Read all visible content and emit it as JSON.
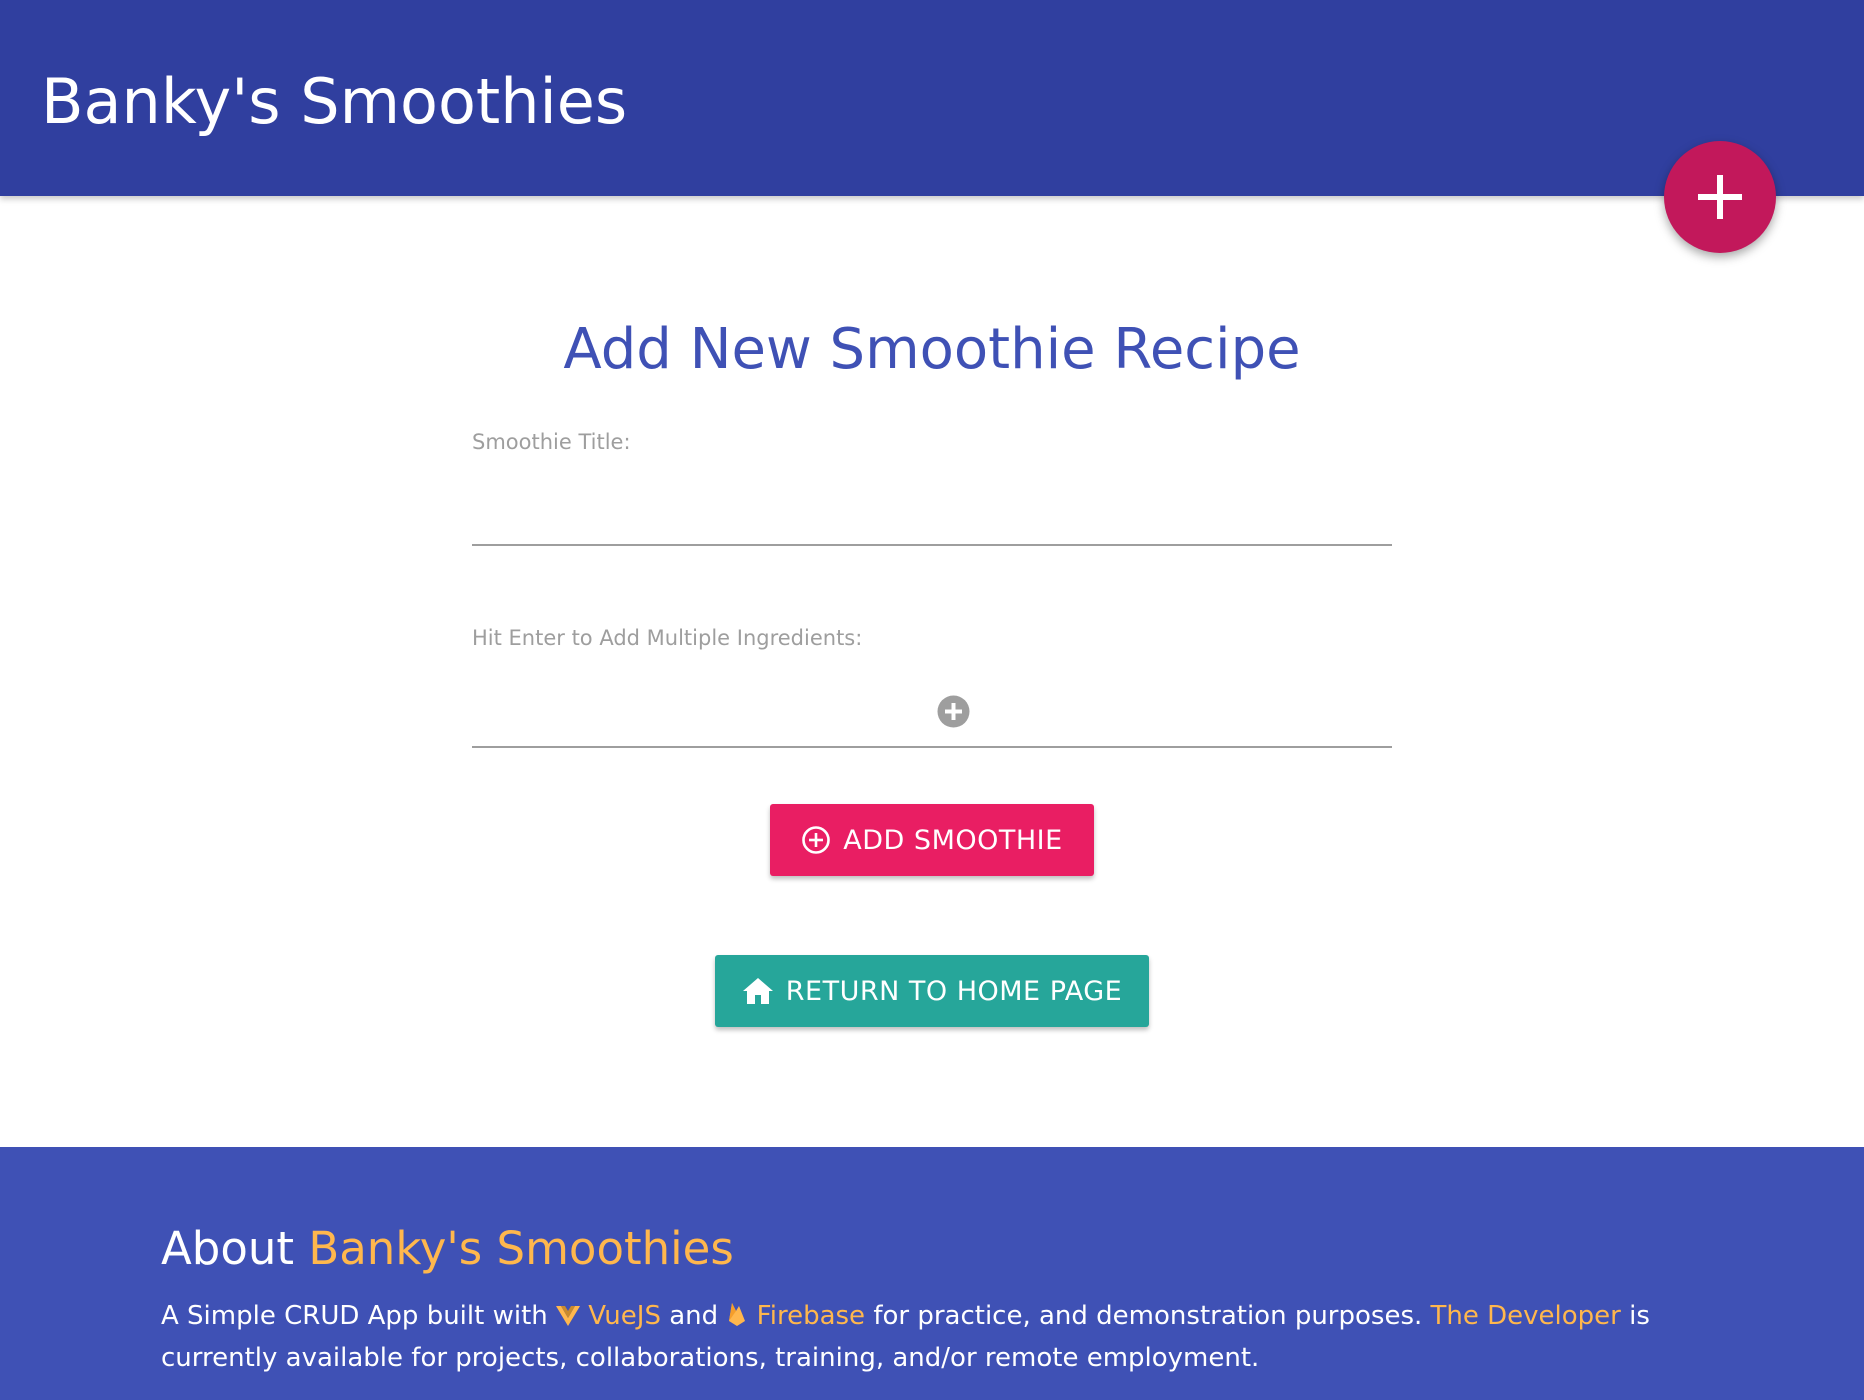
{
  "header": {
    "brand": "Banky's Smoothies",
    "fab_icon": "plus-icon"
  },
  "form": {
    "title": "Add New Smoothie Recipe",
    "smoothie_title_label": "Smoothie Title:",
    "smoothie_title_value": "",
    "ingredients_label": "Hit Enter to Add Multiple Ingredients:",
    "ingredients_value": "",
    "add_ingredient_icon": "add-circle-icon",
    "add_button": "ADD SMOOTHIE",
    "add_button_icon": "add-circle-outline-icon",
    "home_button": "RETURN TO HOME PAGE",
    "home_button_icon": "home-icon"
  },
  "footer": {
    "title_prefix": "About ",
    "title_highlight": "Banky's Smoothies",
    "text_1": "A Simple CRUD App built with ",
    "vue_link": "VueJS",
    "vue_icon": "vue-logo-icon",
    "text_2": " and ",
    "firebase_link": "Firebase",
    "firebase_icon": "firebase-flame-icon",
    "text_3": " for practice, and demonstration purposes. ",
    "developer_link": "The Developer",
    "text_4": " is currently available for projects, collaborations, training, and/or remote employment."
  },
  "colors": {
    "navbar": "#303f9f",
    "fab": "#c2185b",
    "title": "#3f51b5",
    "add_button": "#e91e63",
    "home_button": "#26a69a",
    "footer": "#3f51b5",
    "accent": "#ffb74d"
  }
}
